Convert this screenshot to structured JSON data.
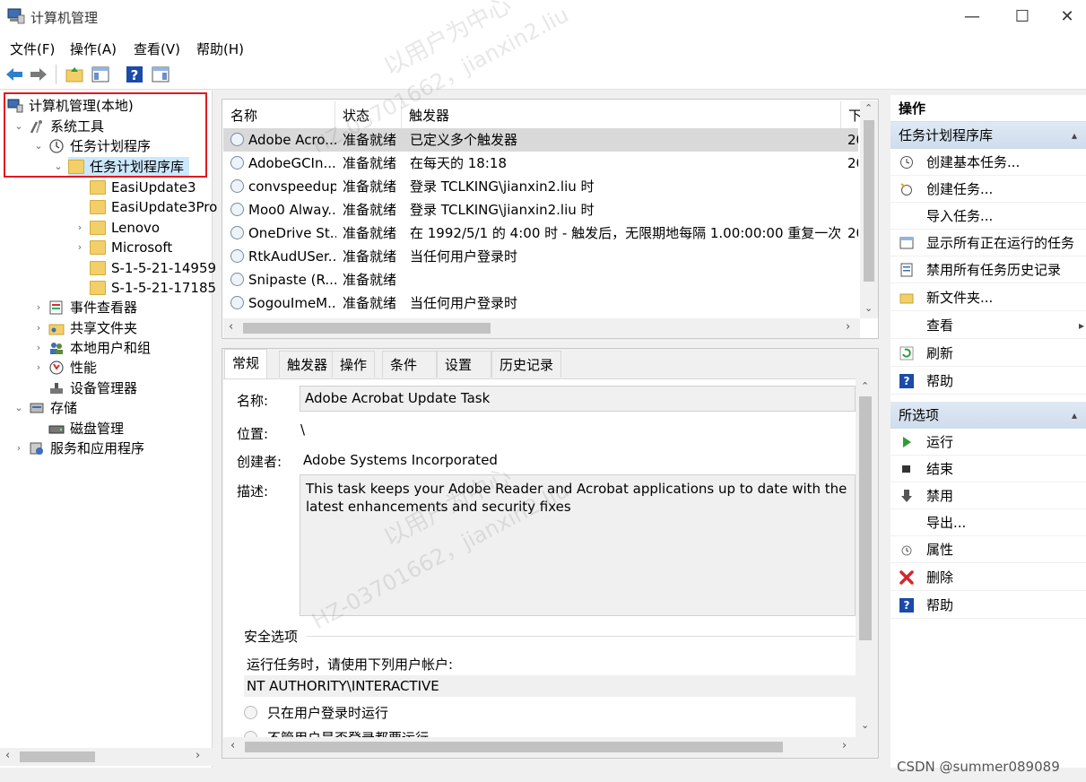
{
  "window": {
    "title": "计算机管理",
    "minimize": "—",
    "maximize": "☐",
    "close": "✕"
  },
  "menu": [
    "文件(F)",
    "操作(A)",
    "查看(V)",
    "帮助(H)"
  ],
  "tree": {
    "root": "计算机管理(本地)",
    "system_tools": "系统工具",
    "task_scheduler": "任务计划程序",
    "task_library": "任务计划程序库",
    "folders": [
      "EasiUpdate3",
      "EasiUpdate3Pro",
      "Lenovo",
      "Microsoft",
      "S-1-5-21-14959",
      "S-1-5-21-17185"
    ],
    "event_viewer": "事件查看器",
    "shared_folders": "共享文件夹",
    "local_users": "本地用户和组",
    "performance": "性能",
    "device_manager": "设备管理器",
    "storage": "存储",
    "disk_management": "磁盘管理",
    "services_apps": "服务和应用程序"
  },
  "task_list": {
    "columns": [
      "名称",
      "状态",
      "触发器",
      "下"
    ],
    "rows": [
      {
        "name": "Adobe Acro...",
        "status": "准备就绪",
        "trigger": "已定义多个触发器",
        "next": "20"
      },
      {
        "name": "AdobeGCIn...",
        "status": "准备就绪",
        "trigger": "在每天的 18:18",
        "next": "20"
      },
      {
        "name": "convspeedup",
        "status": "准备就绪",
        "trigger": "登录 TCLKING\\jianxin2.liu 时",
        "next": ""
      },
      {
        "name": "Moo0 Alway...",
        "status": "准备就绪",
        "trigger": "登录 TCLKING\\jianxin2.liu 时",
        "next": ""
      },
      {
        "name": "OneDrive St...",
        "status": "准备就绪",
        "trigger": "在 1992/5/1 的 4:00 时 - 触发后，无限期地每隔 1.00:00:00 重复一次。",
        "next": "20"
      },
      {
        "name": "RtkAudUSer...",
        "status": "准备就绪",
        "trigger": "当任何用户登录时",
        "next": ""
      },
      {
        "name": "Snipaste (R...",
        "status": "准备就绪",
        "trigger": "",
        "next": ""
      },
      {
        "name": "SogouImeM...",
        "status": "准备就绪",
        "trigger": "当任何用户登录时",
        "next": ""
      }
    ]
  },
  "detail": {
    "tabs": [
      "常规",
      "触发器",
      "操作",
      "条件",
      "设置",
      "历史记录"
    ],
    "name_label": "名称:",
    "name_value": "Adobe Acrobat Update Task",
    "location_label": "位置:",
    "location_value": "\\",
    "author_label": "创建者:",
    "author_value": "Adobe Systems Incorporated",
    "desc_label": "描述:",
    "desc_value": "This task keeps your Adobe Reader and Acrobat applications up to date with the latest enhancements and security fixes",
    "security_title": "安全选项",
    "run_as_label": "运行任务时，请使用下列用户帐户:",
    "run_as_value": "NT AUTHORITY\\INTERACTIVE",
    "radio1": "只在用户登录时运行",
    "radio2": "不管用户是否登录都要运行"
  },
  "actions": {
    "section1": "操作",
    "section2": "任务计划程序库",
    "items2": [
      "创建基本任务...",
      "创建任务...",
      "导入任务...",
      "显示所有正在运行的任务",
      "禁用所有任务历史记录",
      "新文件夹...",
      "查看",
      "刷新",
      "帮助"
    ],
    "section3": "所选项",
    "items3": [
      "运行",
      "结束",
      "禁用",
      "导出...",
      "属性",
      "删除",
      "帮助"
    ]
  },
  "watermarks": [
    "以用户为中心",
    "HZ-03701662，jianxin2.liu"
  ],
  "credit": "CSDN @summer089089"
}
